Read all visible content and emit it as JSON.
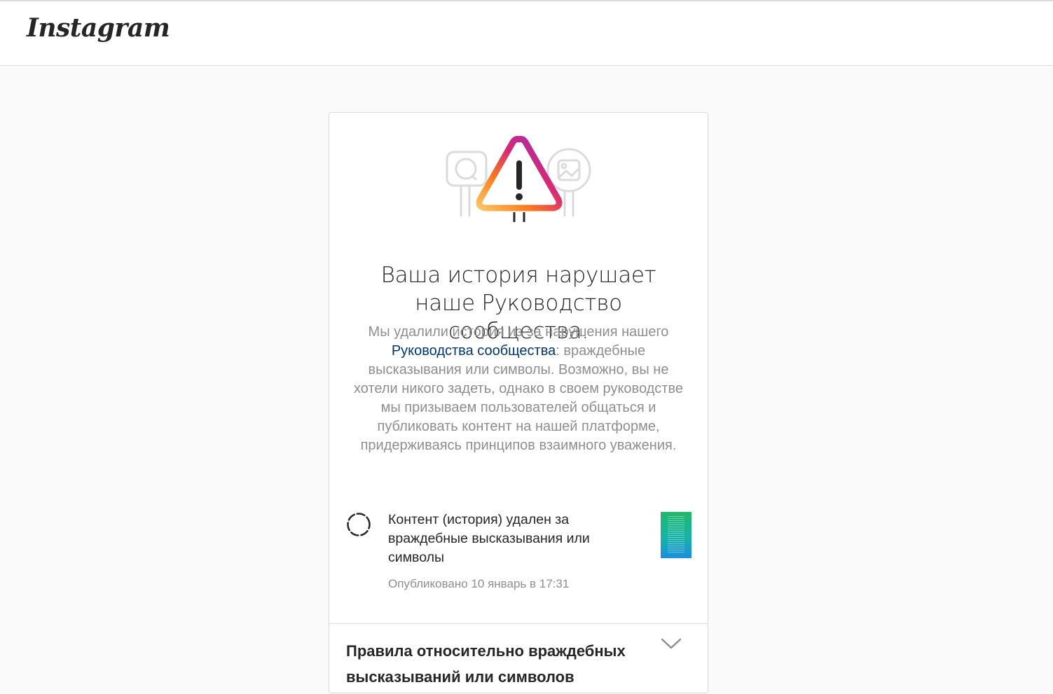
{
  "header": {
    "logo_text": "Instagram"
  },
  "notice": {
    "title": "Ваша история нарушает наше Руководство сообщества.",
    "description_before": "Мы удалили история из-за нарушения нашего ",
    "description_link": "Руководства сообщества",
    "description_after": ": враждебные высказывания или символы. Возможно, вы не хотели никого задеть, однако в своем руководстве мы призываем пользователей общаться и публиковать контент на нашей платформе, придерживаясь принципов взаимного уважения.",
    "link_color": "#00376b"
  },
  "removed_item": {
    "text": "Контент (история) удален за враждебные высказывания или символы",
    "published": "Опубликовано 10 январь в 17:31",
    "status_icon": "story-ring-icon",
    "thumbnail": "story-thumbnail"
  },
  "accordion": {
    "title": "Правила относительно враждебных высказываний или символов",
    "icon": "chevron-down-icon"
  },
  "colors": {
    "background": "#fafafa",
    "card": "#ffffff",
    "border": "#dbdbdb",
    "text_primary": "#262626",
    "text_secondary": "#8e8e8e"
  }
}
